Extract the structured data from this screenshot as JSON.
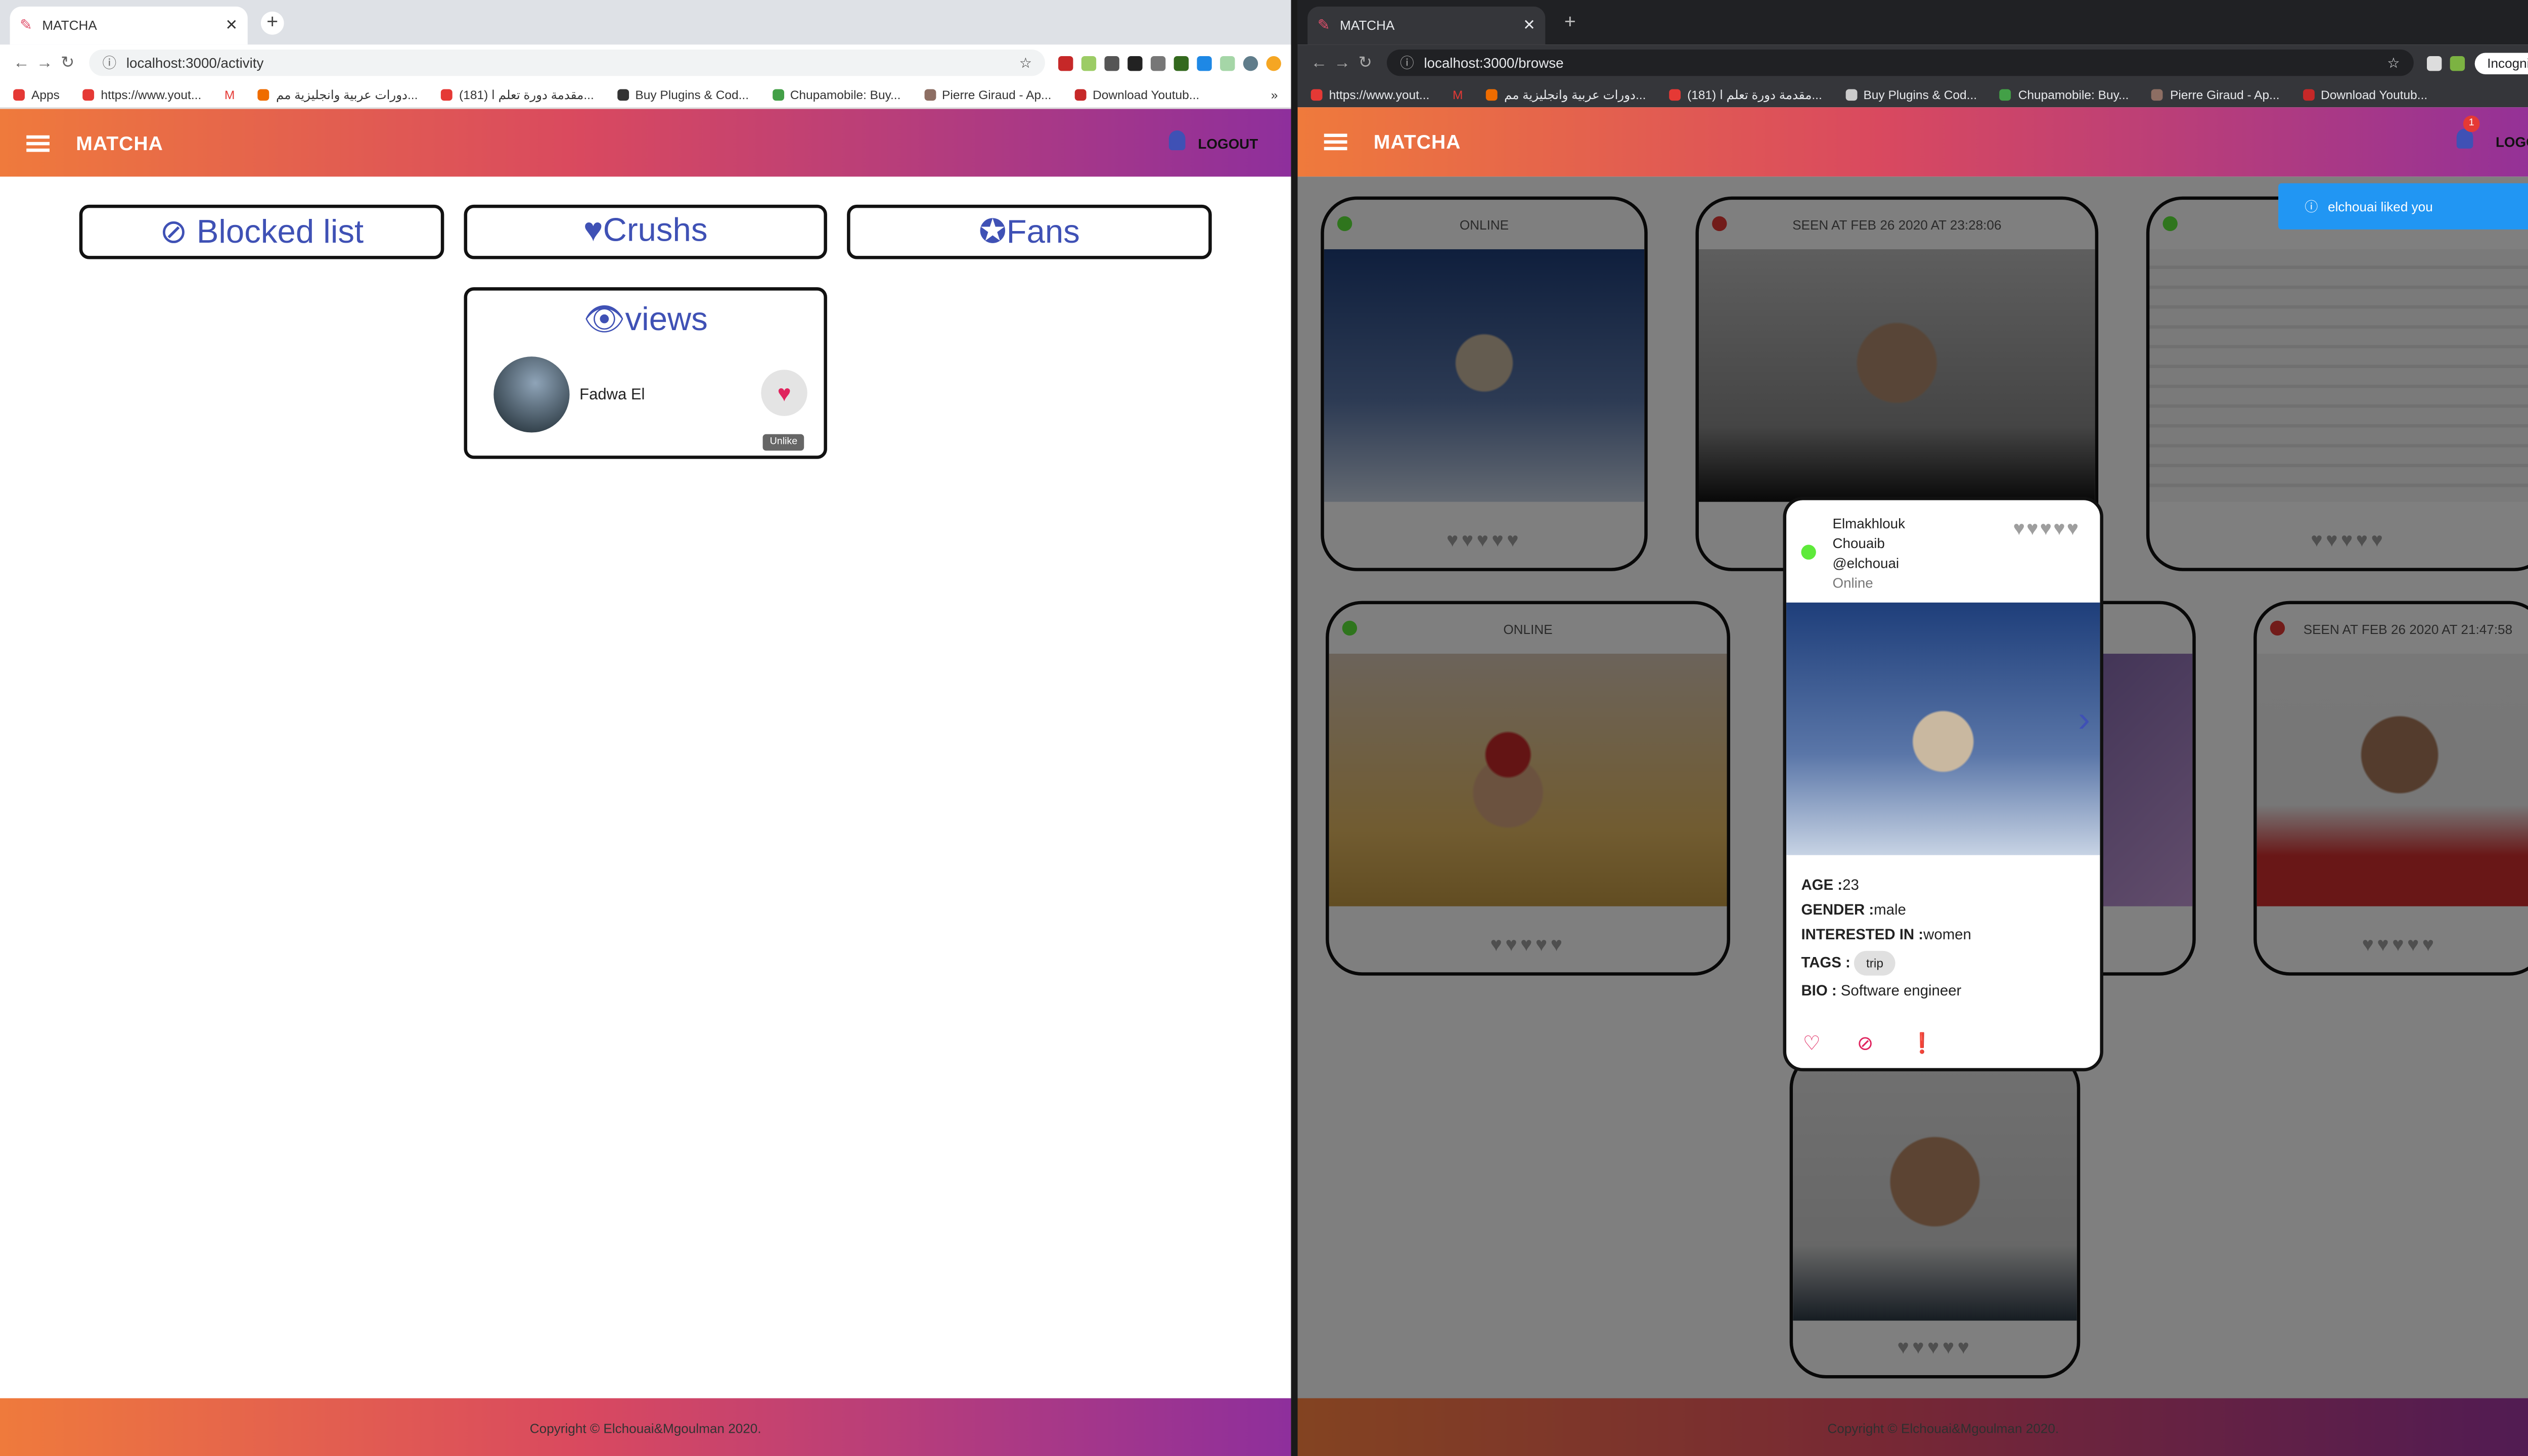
{
  "left": {
    "tab_title": "MATCHA",
    "url": "localhost:3000/activity",
    "bookmarks": [
      "Apps",
      "https://www.yout...",
      "M",
      "دورات عربية وانجليزية مم...",
      "(181) مقدمة دورة تعلم ا...",
      "Buy Plugins & Cod...",
      "Chupamobile: Buy...",
      "Pierre Giraud - Ap...",
      "Download Youtub...",
      "»"
    ],
    "app_title": "MATCHA",
    "logout": "LOGOUT",
    "blocked_label": "⊘ Blocked list",
    "crushs_label": "♥Crushs",
    "fans_label": "✪Fans",
    "views_label": "👁views",
    "view_user_name": "Fadwa El",
    "unlike_tooltip": "Unlike",
    "footer": "Copyright © Elchouai&Mgoulman 2020."
  },
  "right": {
    "tab_title": "MATCHA",
    "url": "localhost:3000/browse",
    "incognito": "Incognito",
    "bookmarks": [
      "https://www.yout...",
      "M",
      "دورات عربية وانجليزية مم...",
      "(181) مقدمة دورة تعلم ا...",
      "Buy Plugins & Cod...",
      "Chupamobile: Buy...",
      "Pierre Giraud - Ap...",
      "Download Youtub...",
      "»"
    ],
    "app_title": "MATCHA",
    "logout": "LOGOUT",
    "notif_count": "1",
    "toast": "elchouai liked you",
    "cards": {
      "c1_status": "ONLINE",
      "c2_status": "SEEN AT FEB 26 2020 AT 23:28:06",
      "c4_status": "ONLINE",
      "c6_status": "SEEN AT FEB 26 2020 AT 21:47:58"
    },
    "hearts": "♥♥♥♥♥",
    "popup": {
      "line1": "Elmakhlouk",
      "line2": "Chouaib",
      "username": "@elchouai",
      "status": "Online",
      "age_label": "AGE :",
      "age": "23",
      "gender_label": "GENDER :",
      "gender": "male",
      "interest_label": "INTERESTED IN :",
      "interest": "women",
      "tags_label": "TAGS :",
      "tag": "trip",
      "bio_label": "BIO :",
      "bio": " Software engineer"
    },
    "footer": "Copyright © Elchouai&Mgoulman 2020."
  },
  "colors": {
    "accent": "#3f51b5",
    "like": "#e0245e",
    "online": "#5eea3a",
    "offline": "#e53935",
    "toast": "#2196f3"
  }
}
